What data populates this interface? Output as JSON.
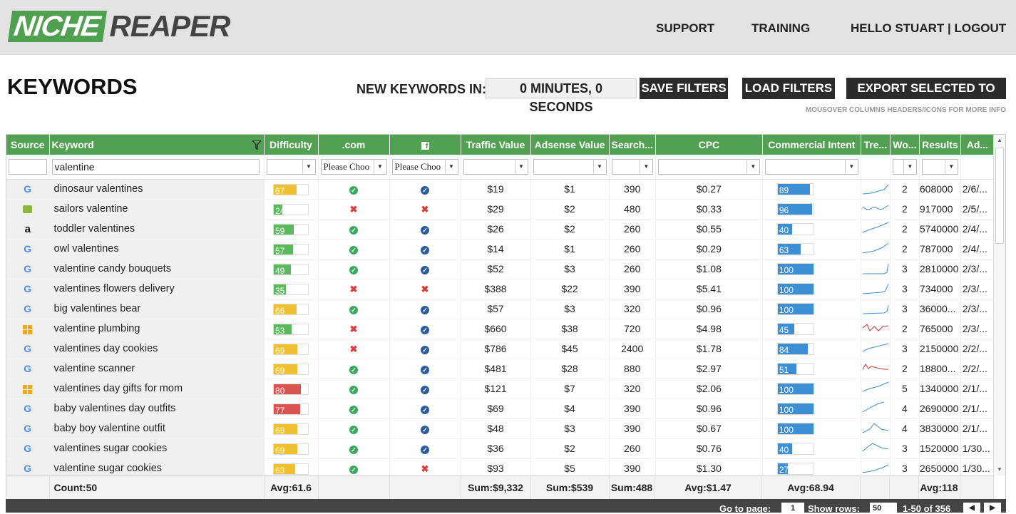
{
  "brand": {
    "part1": "NICHE",
    "part2": "REAPER"
  },
  "nav": {
    "support": "SUPPORT",
    "training": "TRAINING",
    "greeting": "HELLO STUART | LOGOUT"
  },
  "page": {
    "title": "KEYWORDS",
    "new_keywords_label": "NEW KEYWORDS IN:",
    "timer": "0 MINUTES, 0 SECONDS",
    "save_filters": "SAVE FILTERS",
    "load_filters": "LOAD FILTERS",
    "export": "EXPORT SELECTED TO CSV",
    "hint": "MOUSOVER COLUMNS HEADERS/ICONS FOR MORE INFO"
  },
  "columns": [
    "Source",
    "Keyword",
    "Difficulty",
    ".com",
    "",
    "Traffic Value",
    "Adsense Value",
    "Search...",
    "CPC",
    "Commercial Intent",
    "Tre...",
    "Wo...",
    "Results",
    "Ad..."
  ],
  "filters": {
    "keyword": "valentine",
    "com_placeholder": "Please Choo",
    "fb_placeholder": "Please Choo"
  },
  "colors": {
    "header_green": "#52a152",
    "diff_green": "#5cb85c",
    "diff_yellow": "#f0c030",
    "diff_red": "#d9534f",
    "ci_blue": "#3d8fd4",
    "trend_blue": "#3d8fd4",
    "trend_red": "#d9312b"
  },
  "rows": [
    {
      "src": "google",
      "kw": "dinosaur valentines",
      "diff": 67,
      "com": "check",
      "fb": "check",
      "tv": "$19",
      "av": "$1",
      "sv": "390",
      "cpc": "$0.27",
      "ci": 89,
      "trend": "blue",
      "wo": "2",
      "res": "608000",
      "ad": "2/6/..."
    },
    {
      "src": "bag",
      "kw": "sailors valentine",
      "diff": 24,
      "com": "x",
      "fb": "x",
      "tv": "$29",
      "av": "$2",
      "sv": "480",
      "cpc": "$0.33",
      "ci": 96,
      "trend": "blue",
      "wo": "2",
      "res": "917000",
      "ad": "2/5/..."
    },
    {
      "src": "amazon",
      "kw": "toddler valentines",
      "diff": 59,
      "com": "check",
      "fb": "check",
      "tv": "$26",
      "av": "$2",
      "sv": "260",
      "cpc": "$0.55",
      "ci": 40,
      "trend": "blue",
      "wo": "2",
      "res": "5740000",
      "ad": "2/4/..."
    },
    {
      "src": "google",
      "kw": "owl valentines",
      "diff": 57,
      "com": "check",
      "fb": "check",
      "tv": "$14",
      "av": "$1",
      "sv": "260",
      "cpc": "$0.29",
      "ci": 63,
      "trend": "blue",
      "wo": "2",
      "res": "787000",
      "ad": "2/4/..."
    },
    {
      "src": "google",
      "kw": "valentine candy bouquets",
      "diff": 49,
      "com": "check",
      "fb": "check",
      "tv": "$52",
      "av": "$3",
      "sv": "260",
      "cpc": "$1.08",
      "ci": 100,
      "trend": "blue",
      "wo": "3",
      "res": "2810000",
      "ad": "2/3/..."
    },
    {
      "src": "google",
      "kw": "valentines flowers delivery",
      "diff": 35,
      "com": "x",
      "fb": "x",
      "tv": "$388",
      "av": "$22",
      "sv": "390",
      "cpc": "$5.41",
      "ci": 100,
      "trend": "blue",
      "wo": "3",
      "res": "734000",
      "ad": "2/3/..."
    },
    {
      "src": "google",
      "kw": "big valentines bear",
      "diff": 66,
      "com": "check",
      "fb": "check",
      "tv": "$57",
      "av": "$3",
      "sv": "320",
      "cpc": "$0.96",
      "ci": 100,
      "trend": "blue",
      "wo": "3",
      "res": "36000...",
      "ad": "2/3/..."
    },
    {
      "src": "windows",
      "kw": "valentine plumbing",
      "diff": 53,
      "com": "x",
      "fb": "check",
      "tv": "$660",
      "av": "$38",
      "sv": "720",
      "cpc": "$4.98",
      "ci": 45,
      "trend": "red",
      "wo": "2",
      "res": "765000",
      "ad": "2/3/..."
    },
    {
      "src": "google",
      "kw": "valentines day cookies",
      "diff": 69,
      "com": "x",
      "fb": "check",
      "tv": "$786",
      "av": "$45",
      "sv": "2400",
      "cpc": "$1.78",
      "ci": 84,
      "trend": "blue",
      "wo": "3",
      "res": "2150000",
      "ad": "2/2/..."
    },
    {
      "src": "google",
      "kw": "valentine scanner",
      "diff": 69,
      "com": "check",
      "fb": "check",
      "tv": "$481",
      "av": "$28",
      "sv": "880",
      "cpc": "$2.97",
      "ci": 51,
      "trend": "red",
      "wo": "2",
      "res": "18800...",
      "ad": "2/2/..."
    },
    {
      "src": "windows",
      "kw": "valentines day gifts for mom",
      "diff": 80,
      "com": "check",
      "fb": "check",
      "tv": "$121",
      "av": "$7",
      "sv": "320",
      "cpc": "$2.06",
      "ci": 100,
      "trend": "blue",
      "wo": "5",
      "res": "1340000",
      "ad": "2/1/..."
    },
    {
      "src": "google",
      "kw": "baby valentines day outfits",
      "diff": 77,
      "com": "check",
      "fb": "check",
      "tv": "$69",
      "av": "$4",
      "sv": "390",
      "cpc": "$0.96",
      "ci": 100,
      "trend": "blue",
      "wo": "4",
      "res": "2690000",
      "ad": "2/1/..."
    },
    {
      "src": "google",
      "kw": "baby boy valentine outfit",
      "diff": 69,
      "com": "check",
      "fb": "check",
      "tv": "$48",
      "av": "$3",
      "sv": "390",
      "cpc": "$0.67",
      "ci": 100,
      "trend": "blue",
      "wo": "4",
      "res": "3830000",
      "ad": "2/1/..."
    },
    {
      "src": "google",
      "kw": "valentines sugar cookies",
      "diff": 69,
      "com": "check",
      "fb": "check",
      "tv": "$36",
      "av": "$2",
      "sv": "260",
      "cpc": "$0.76",
      "ci": 40,
      "trend": "blue",
      "wo": "3",
      "res": "1520000",
      "ad": "1/30..."
    },
    {
      "src": "google",
      "kw": "valentine sugar cookies",
      "diff": 63,
      "com": "check",
      "fb": "x",
      "tv": "$93",
      "av": "$5",
      "sv": "390",
      "cpc": "$1.30",
      "ci": 27,
      "trend": "blue",
      "wo": "3",
      "res": "2650000",
      "ad": "1/30..."
    }
  ],
  "footer": {
    "count": "Count:50",
    "avg_diff": "Avg:61.6",
    "sum_tv": "Sum:$9,332",
    "sum_av": "Sum:$539",
    "sum_sv": "Sum:488",
    "avg_cpc": "Avg:$1.47",
    "avg_ci": "Avg:68.94",
    "avg_res": "Avg:118"
  },
  "pager": {
    "goto": "Go to page:",
    "page": "1",
    "show_rows": "Show rows:",
    "rows": "50",
    "range": "1-50 of 356"
  }
}
